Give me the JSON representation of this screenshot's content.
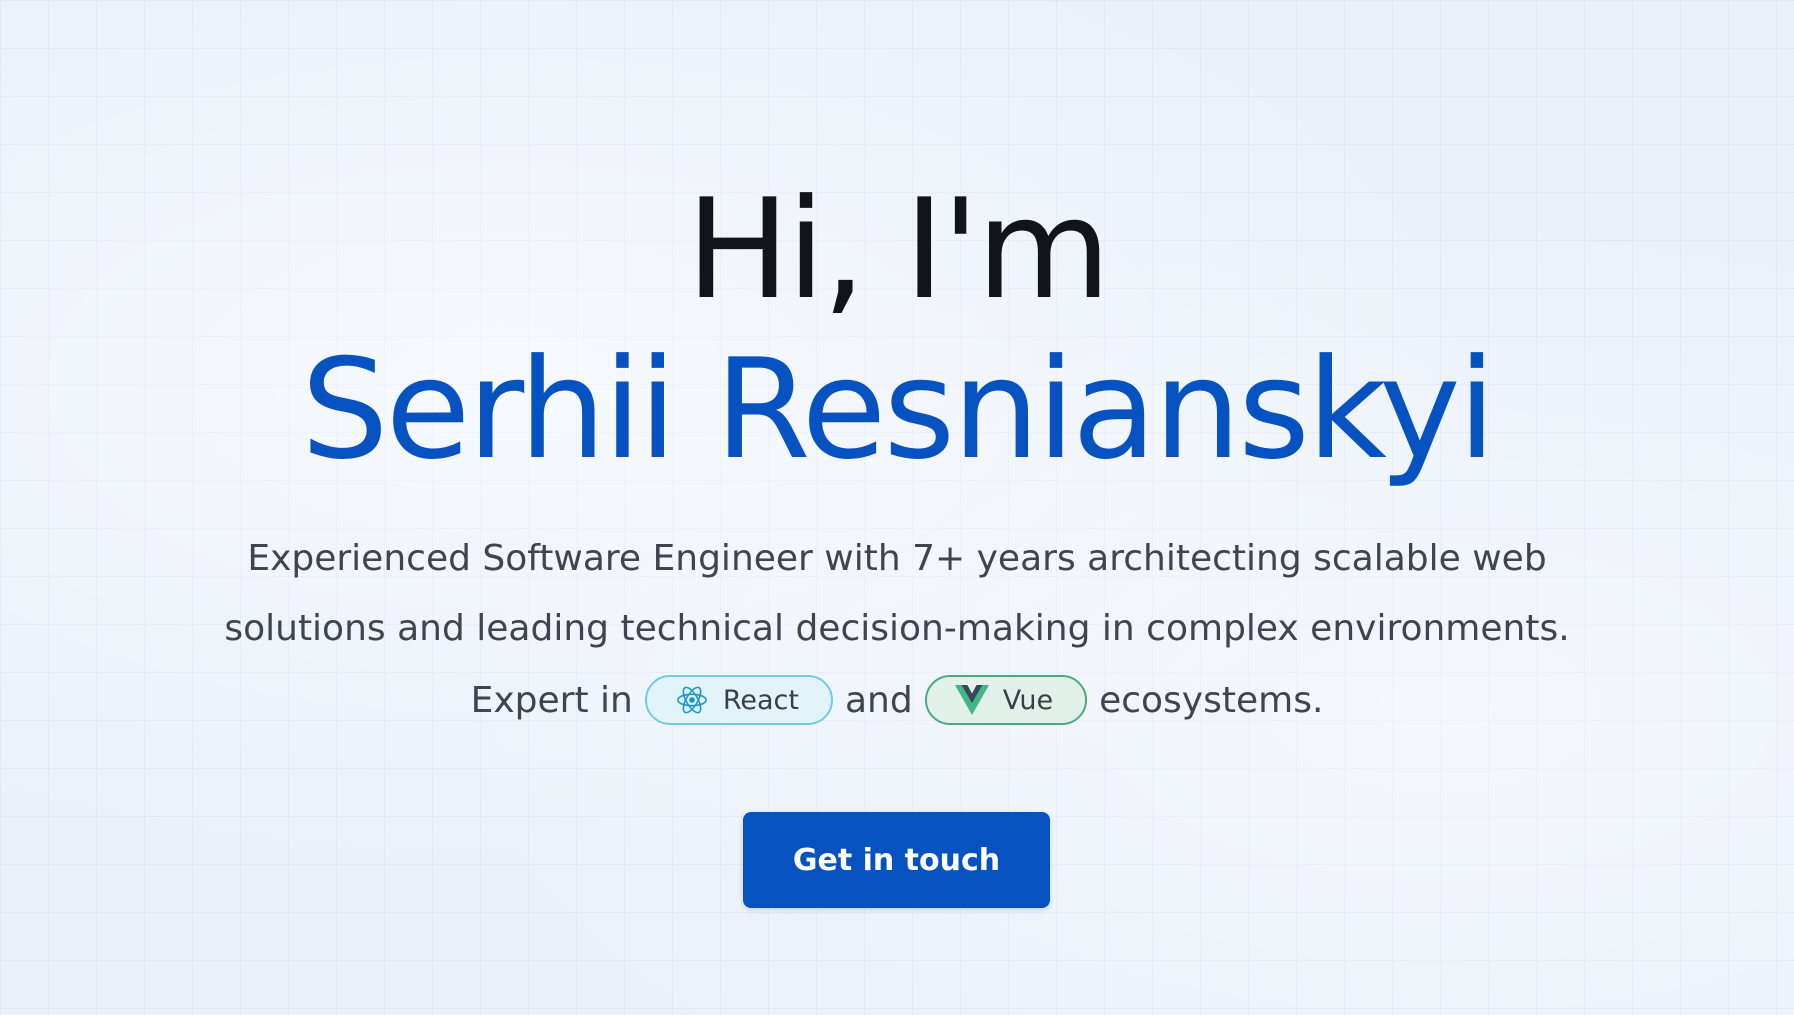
{
  "hero": {
    "greeting": "Hi, I'm",
    "name": "Serhii Resnianskyi",
    "description_line_1": "Experienced Software Engineer with 7+ years architecting scalable web",
    "description_line_2": "solutions and leading technical decision-making in complex environments.",
    "expert_prefix": "Expert in",
    "conjunction": "and",
    "expert_suffix": "ecosystems.",
    "pills": [
      {
        "label": "React",
        "icon": "react-icon"
      },
      {
        "label": "Vue",
        "icon": "vue-icon"
      }
    ],
    "cta_label": "Get in touch"
  },
  "colors": {
    "background": "#ebf1fa",
    "heading": "#111418",
    "accent": "#0752c1",
    "body_text": "#3f444d",
    "react_brand": "#1796c8",
    "vue_green": "#41b883",
    "vue_dark": "#35495e"
  }
}
